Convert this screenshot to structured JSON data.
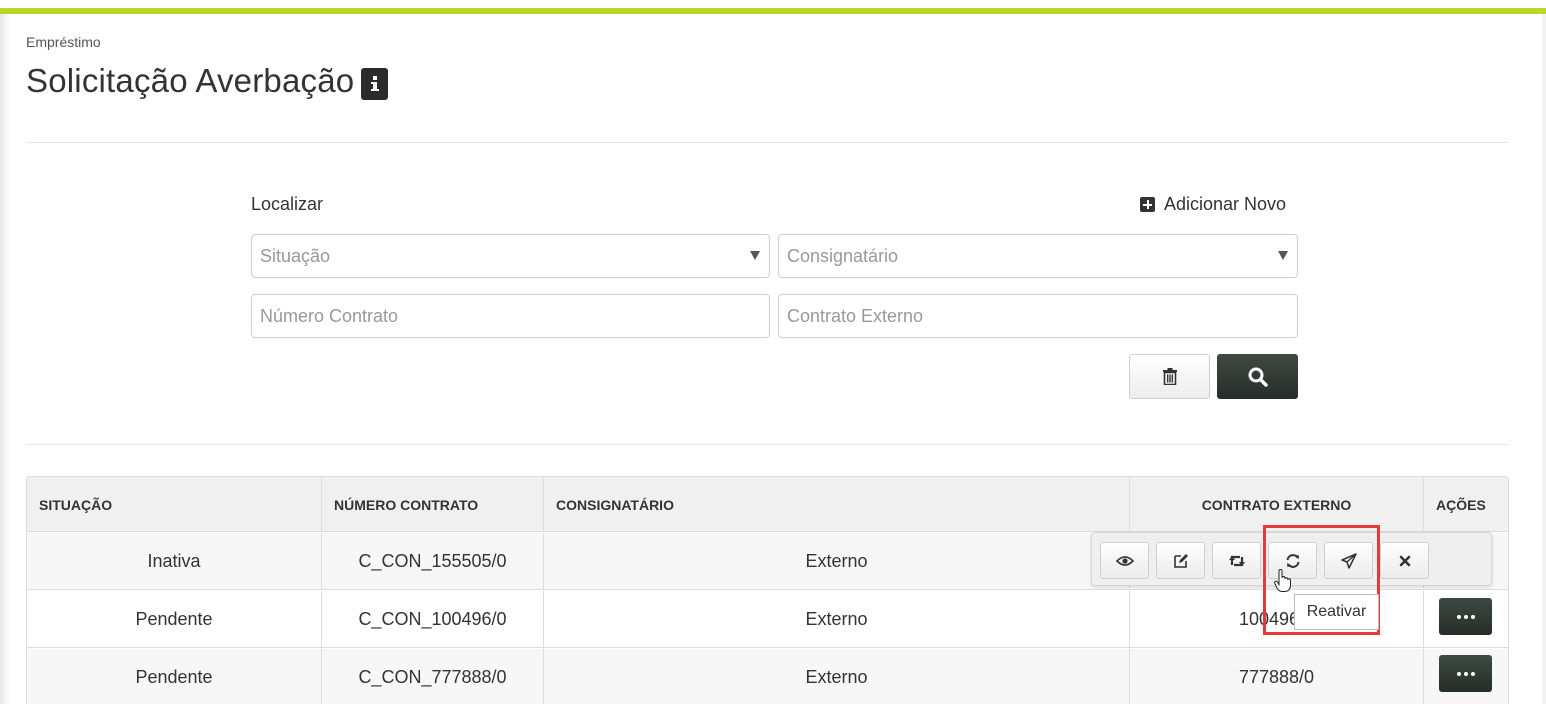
{
  "breadcrumb": "Empréstimo",
  "page_title": "Solicitação Averbação",
  "search": {
    "label": "Localizar",
    "add_new": "Adicionar Novo",
    "situacao_placeholder": "Situação",
    "consignatario_placeholder": "Consignatário",
    "numero_contrato_placeholder": "Número Contrato",
    "contrato_externo_placeholder": "Contrato Externo"
  },
  "table": {
    "headers": {
      "situacao": "SITUAÇÃO",
      "numero_contrato": "NÚMERO CONTRATO",
      "consignatario": "CONSIGNATÁRIO",
      "contrato_externo": "CONTRATO EXTERNO",
      "acoes": "AÇÕES"
    },
    "rows": [
      {
        "situacao": "Inativa",
        "numero_contrato": "C_CON_155505/0",
        "consignatario": "Externo",
        "contrato_externo": ""
      },
      {
        "situacao": "Pendente",
        "numero_contrato": "C_CON_100496/0",
        "consignatario": "Externo",
        "contrato_externo": "100496/0"
      },
      {
        "situacao": "Pendente",
        "numero_contrato": "C_CON_777888/0",
        "consignatario": "Externo",
        "contrato_externo": "777888/0"
      }
    ]
  },
  "row_actions": [
    "eye-icon",
    "edit-icon",
    "retweet-icon",
    "refresh-icon",
    "send-icon",
    "close-icon"
  ],
  "tooltip": "Reativar",
  "colors": {
    "accent_bar": "#b8d82a",
    "dark_button": "#2f3833",
    "highlight": "#e43a3a"
  }
}
